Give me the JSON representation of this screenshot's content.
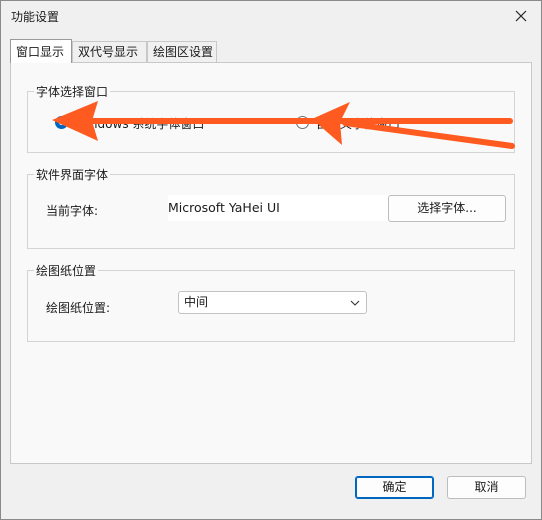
{
  "window": {
    "title": "功能设置"
  },
  "tabs": [
    {
      "label": "窗口显示",
      "active": true
    },
    {
      "label": "双代号显示",
      "active": false
    },
    {
      "label": "绘图区设置",
      "active": false
    }
  ],
  "font_dialog_group": {
    "title": "字体选择窗口",
    "options": [
      {
        "label": "Windows 系统字体窗口",
        "selected": true
      },
      {
        "label": "自定义字体窗口",
        "selected": false
      }
    ]
  },
  "ui_font_group": {
    "title": "软件界面字体",
    "current_label": "当前字体:",
    "current_value": "Microsoft YaHei UI",
    "choose_button": "选择字体..."
  },
  "paper_group": {
    "title": "绘图纸位置",
    "position_label": "绘图纸位置:",
    "position_value": "中间"
  },
  "footer": {
    "ok_label": "确定",
    "cancel_label": "取消"
  },
  "annotation": {
    "arrow_color": "#ff5a1f"
  }
}
